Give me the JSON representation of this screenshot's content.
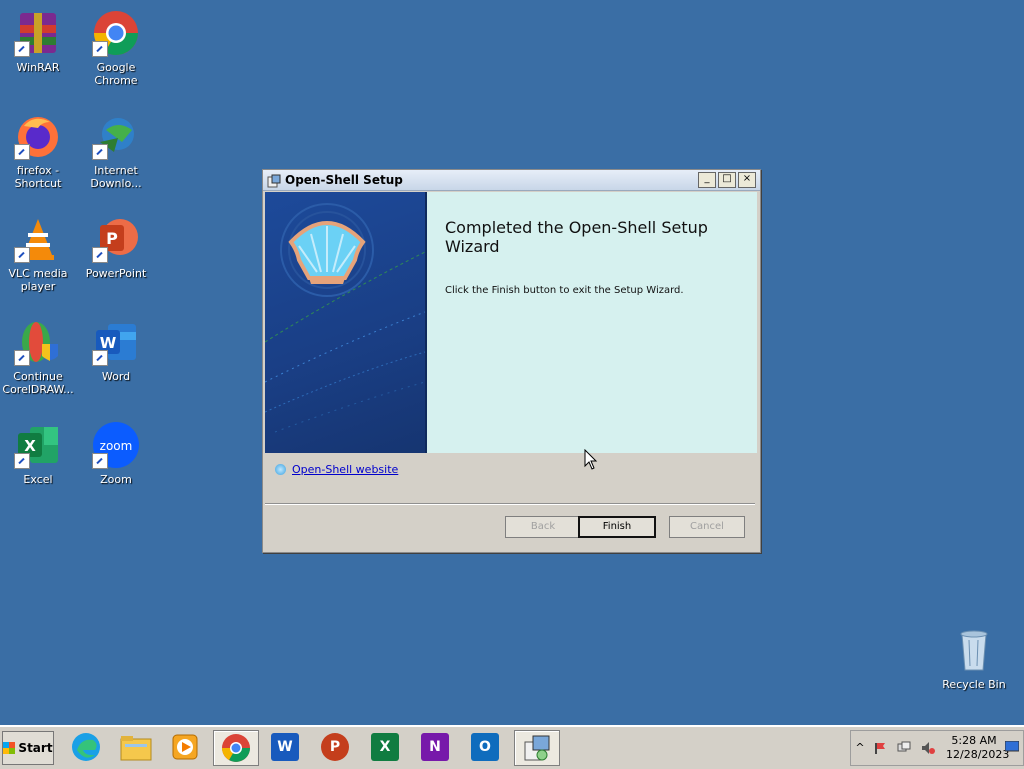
{
  "desktop_icons": [
    {
      "label": "WinRAR",
      "icon": "winrar-icon"
    },
    {
      "label": "Google Chrome",
      "icon": "chrome-icon"
    },
    {
      "label": "firefox - Shortcut",
      "icon": "firefox-icon"
    },
    {
      "label": "Internet Downlo...",
      "icon": "idm-icon"
    },
    {
      "label": "VLC media player",
      "icon": "vlc-icon"
    },
    {
      "label": "PowerPoint",
      "icon": "powerpoint-icon"
    },
    {
      "label": "Continue CorelDRAW...",
      "icon": "coreldraw-icon"
    },
    {
      "label": "Word",
      "icon": "word-icon"
    },
    {
      "label": "Excel",
      "icon": "excel-icon"
    },
    {
      "label": "Zoom",
      "icon": "zoom-icon"
    }
  ],
  "recycle_bin": {
    "label": "Recycle Bin"
  },
  "window": {
    "title": "Open-Shell Setup",
    "heading": "Completed the Open-Shell Setup Wizard",
    "text": "Click the Finish button to exit the Setup Wizard.",
    "link": "Open-Shell website",
    "buttons": {
      "back": "Back",
      "finish": "Finish",
      "cancel": "Cancel"
    },
    "controls": {
      "minimize": "_",
      "maximize": "□",
      "close": "×"
    }
  },
  "taskbar": {
    "start_label": "Start",
    "apps": [
      "edge-icon",
      "file-explorer-icon",
      "media-player-icon",
      "chrome-icon",
      "word-icon",
      "powerpoint-icon",
      "excel-icon",
      "onenote-icon",
      "outlook-icon",
      "setup-icon"
    ],
    "tray": {
      "chevron": "^",
      "time": "5:28 AM",
      "date": "12/28/2023"
    }
  },
  "colors": {
    "desktop": "#3a6ea5",
    "banner": "#d6f1ef",
    "panel": "#1a3f86"
  }
}
